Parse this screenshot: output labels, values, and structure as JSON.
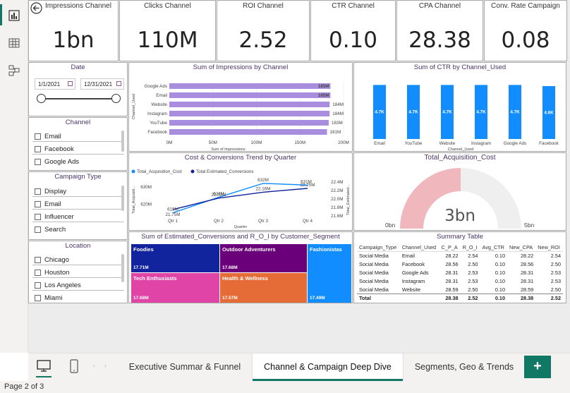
{
  "kpis": [
    {
      "title": "Impressions Channel",
      "value": "1bn"
    },
    {
      "title": "Clicks Channel",
      "value": "110M"
    },
    {
      "title": "ROI Channel",
      "value": "2.52"
    },
    {
      "title": "CTR Channel",
      "value": "0.10"
    },
    {
      "title": "CPA Channel",
      "value": "28.38"
    },
    {
      "title": "Conv. Rate Campaign",
      "value": "0.08"
    }
  ],
  "date_slicer": {
    "title": "Date",
    "start": "1/1/2021",
    "end": "12/31/2021"
  },
  "channel_slicer": {
    "title": "Channel",
    "items": [
      "Email",
      "Facebook",
      "Google Ads"
    ]
  },
  "campaign_slicer": {
    "title": "Campaign Type",
    "items": [
      "Display",
      "Email",
      "Influencer",
      "Search"
    ]
  },
  "location_slicer": {
    "title": "Location",
    "items": [
      "Chicago",
      "Houston",
      "Los Angeles",
      "Miami"
    ]
  },
  "impressions_chart": {
    "title": "Sum of Impressions by Channel",
    "xlabel": "Sum of Impressions",
    "ylabel": "Channel_Used",
    "x_ticks": [
      "0M",
      "50M",
      "100M",
      "150M",
      "200M"
    ],
    "chart_data": {
      "type": "bar",
      "categories": [
        "Google Ads",
        "Email",
        "Website",
        "Instagram",
        "YouTube",
        "Facebook"
      ],
      "values": [
        185,
        185,
        184,
        184,
        183,
        181
      ],
      "labels": [
        "185M",
        "185M",
        "184M",
        "184M",
        "183M",
        "181M"
      ],
      "xlim": [
        0,
        200
      ]
    }
  },
  "ctr_chart": {
    "title": "Sum of CTR by Channel_Used",
    "xlabel": "Channel_Used",
    "chart_data": {
      "type": "bar",
      "categories": [
        "Email",
        "YouTube",
        "Website",
        "Instagram",
        "Google Ads",
        "Facebook"
      ],
      "values": [
        4.7,
        4.7,
        4.7,
        4.7,
        4.7,
        4.6
      ],
      "labels": [
        "4.7K",
        "4.7K",
        "4.7K",
        "4.7K",
        "4.7K",
        "4.6K"
      ],
      "ylim": [
        0,
        5.4
      ]
    }
  },
  "trend_chart": {
    "title": "Cost & Conversions Trend by Quarter",
    "legend": [
      "Total_Acquisition_Cost",
      "Total Estimated_Conversions"
    ],
    "xlabel": "Quarter",
    "ylabel_left": "Total_Acquisiti...",
    "ylabel_right": "Total_Estimated...",
    "left_ticks": [
      "630M",
      "620M"
    ],
    "right_ticks": [
      "22.4M",
      "22.2M",
      "22.0M",
      "21.8M",
      "21.6M"
    ],
    "chart_data": {
      "type": "line",
      "categories": [
        "Qtr 1",
        "Qtr 2",
        "Qtr 3",
        "Qtr 4"
      ],
      "series": [
        {
          "name": "Total_Acquisition_Cost",
          "values": [
            615,
            624,
            632,
            631
          ],
          "labels": [
            "615M",
            "624M",
            "632M",
            "631M"
          ]
        },
        {
          "name": "Total Estimated_Conversions",
          "values": [
            21.75,
            22.02,
            22.16,
            22.25
          ],
          "labels": [
            "21.75M",
            "22.02M",
            "22.16M",
            "22.25M"
          ]
        }
      ]
    }
  },
  "gauge": {
    "title": "Total_Acquisition_Cost",
    "value": "3bn",
    "min": "0bn",
    "max": "5bn",
    "fraction": 0.5
  },
  "treemap": {
    "title": "Sum of Estimated_Conversions and R_O_I by Customer_Segment",
    "cells": [
      {
        "name": "Foodies",
        "value": "17.71M",
        "color": "#12239e"
      },
      {
        "name": "Outdoor Adventurers",
        "value": "17.68M",
        "color": "#6b007b"
      },
      {
        "name": "Fashionistas",
        "value": "17.49M",
        "color": "#118dff"
      },
      {
        "name": "Tech Enthusiasts",
        "value": "17.68M",
        "color": "#e044a7"
      },
      {
        "name": "Health & Wellness",
        "value": "17.57M",
        "color": "#e66c37"
      }
    ]
  },
  "summary_table": {
    "title": "Summary Table",
    "headers": [
      "Campaign_Type",
      "Channel_Used",
      "C_P_A",
      "R_O_I",
      "Avg_CTR",
      "New_CPA",
      "New_ROI"
    ],
    "rows": [
      [
        "Social Media",
        "Email",
        "28.22",
        "2.54",
        "0.10",
        "28.22",
        "2.54"
      ],
      [
        "Social Media",
        "Facebook",
        "28.56",
        "2.50",
        "0.10",
        "28.56",
        "2.50"
      ],
      [
        "Social Media",
        "Google Ads",
        "28.31",
        "2.53",
        "0.10",
        "28.31",
        "2.53"
      ],
      [
        "Social Media",
        "Instagram",
        "28.31",
        "2.53",
        "0.10",
        "28.31",
        "2.53"
      ],
      [
        "Social Media",
        "Website",
        "28.59",
        "2.50",
        "0.10",
        "28.59",
        "2.50"
      ]
    ],
    "total": [
      "Total",
      "",
      "28.38",
      "2.52",
      "0.10",
      "28.38",
      "2.52"
    ]
  },
  "tabs": [
    "Executive Summar & Funnel",
    "Channel & Campaign Deep Dive",
    "Segments, Geo & Trends"
  ],
  "active_tab": 1,
  "add_page_label": "+",
  "status": "Page 2 of 3"
}
